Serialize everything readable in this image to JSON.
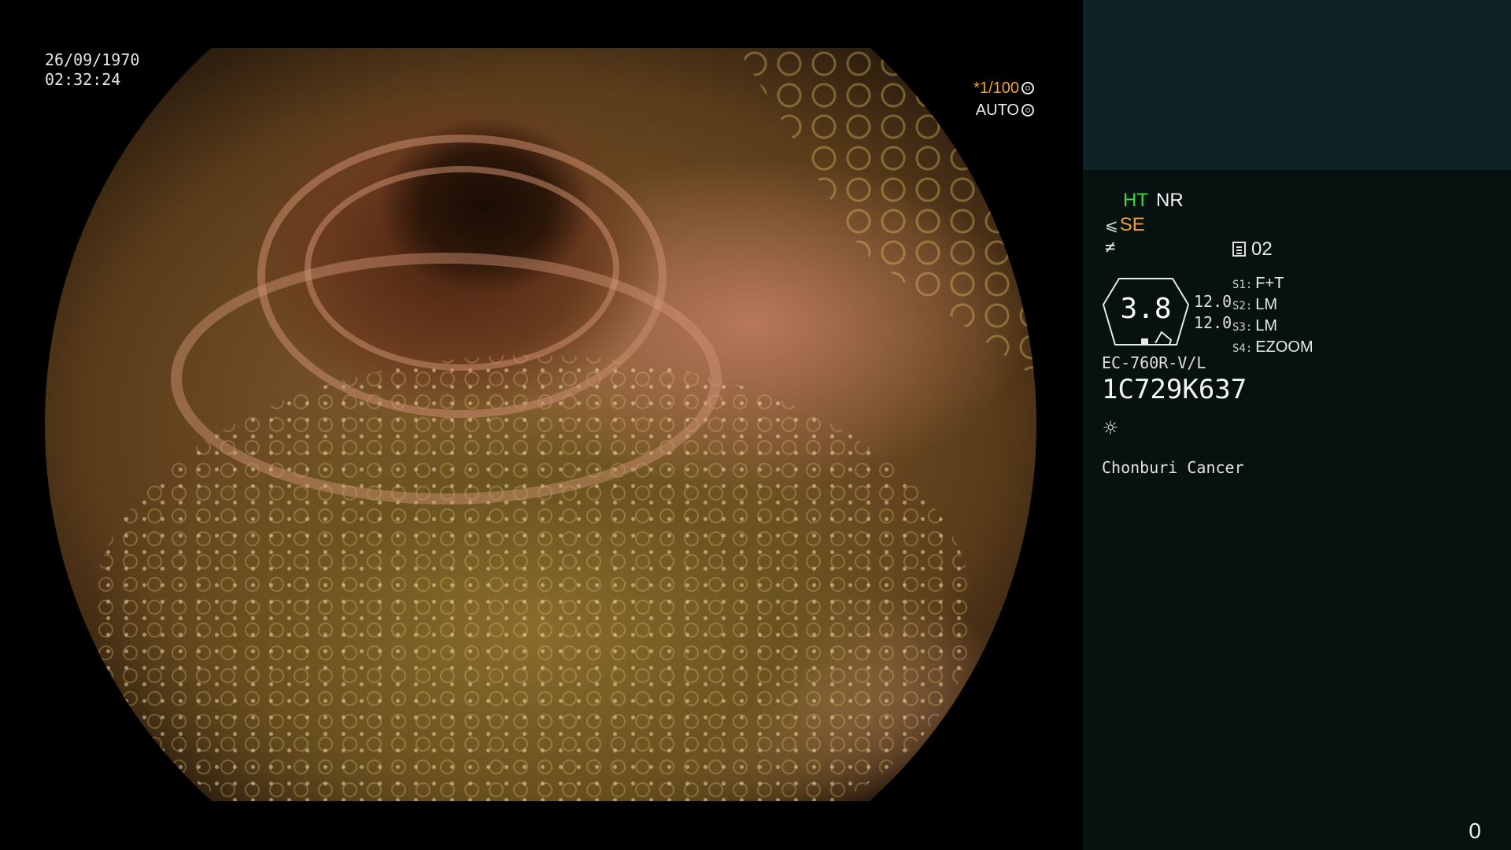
{
  "header": {
    "date": "26/09/1970",
    "time": "02:32:24",
    "shutter_value": "*1/100",
    "shutter_mode": "AUTO"
  },
  "status_panel": {
    "ht_label": "HT",
    "nr_label": "NR",
    "se_label": "SE",
    "preset_number": "02",
    "zoom_value": "3.8",
    "value_1": "12.0",
    "value_2": "12.0",
    "switches": [
      {
        "key": "S1:",
        "value": "F+T"
      },
      {
        "key": "S2:",
        "value": "LM"
      },
      {
        "key": "S3:",
        "value": "LM"
      },
      {
        "key": "S4:",
        "value": "EZOOM"
      }
    ],
    "scope_model": "EC-760R-V/L",
    "serial_number": "1C729K637",
    "institution": "Chonburi Cancer",
    "counter": "0"
  },
  "icons": {
    "shutter_icon": "aperture-icon",
    "auto_icon": "auto-iris-icon",
    "se_icon": "scope-angle-icon",
    "neq_icon": "not-equal-icon",
    "preset_icon": "memory-card-icon",
    "light_icon": "sun-icon"
  },
  "colors": {
    "panel_top": "#0f2326",
    "panel": "#061110",
    "ht_green": "#33dd44",
    "se_orange": "#f0a030"
  }
}
